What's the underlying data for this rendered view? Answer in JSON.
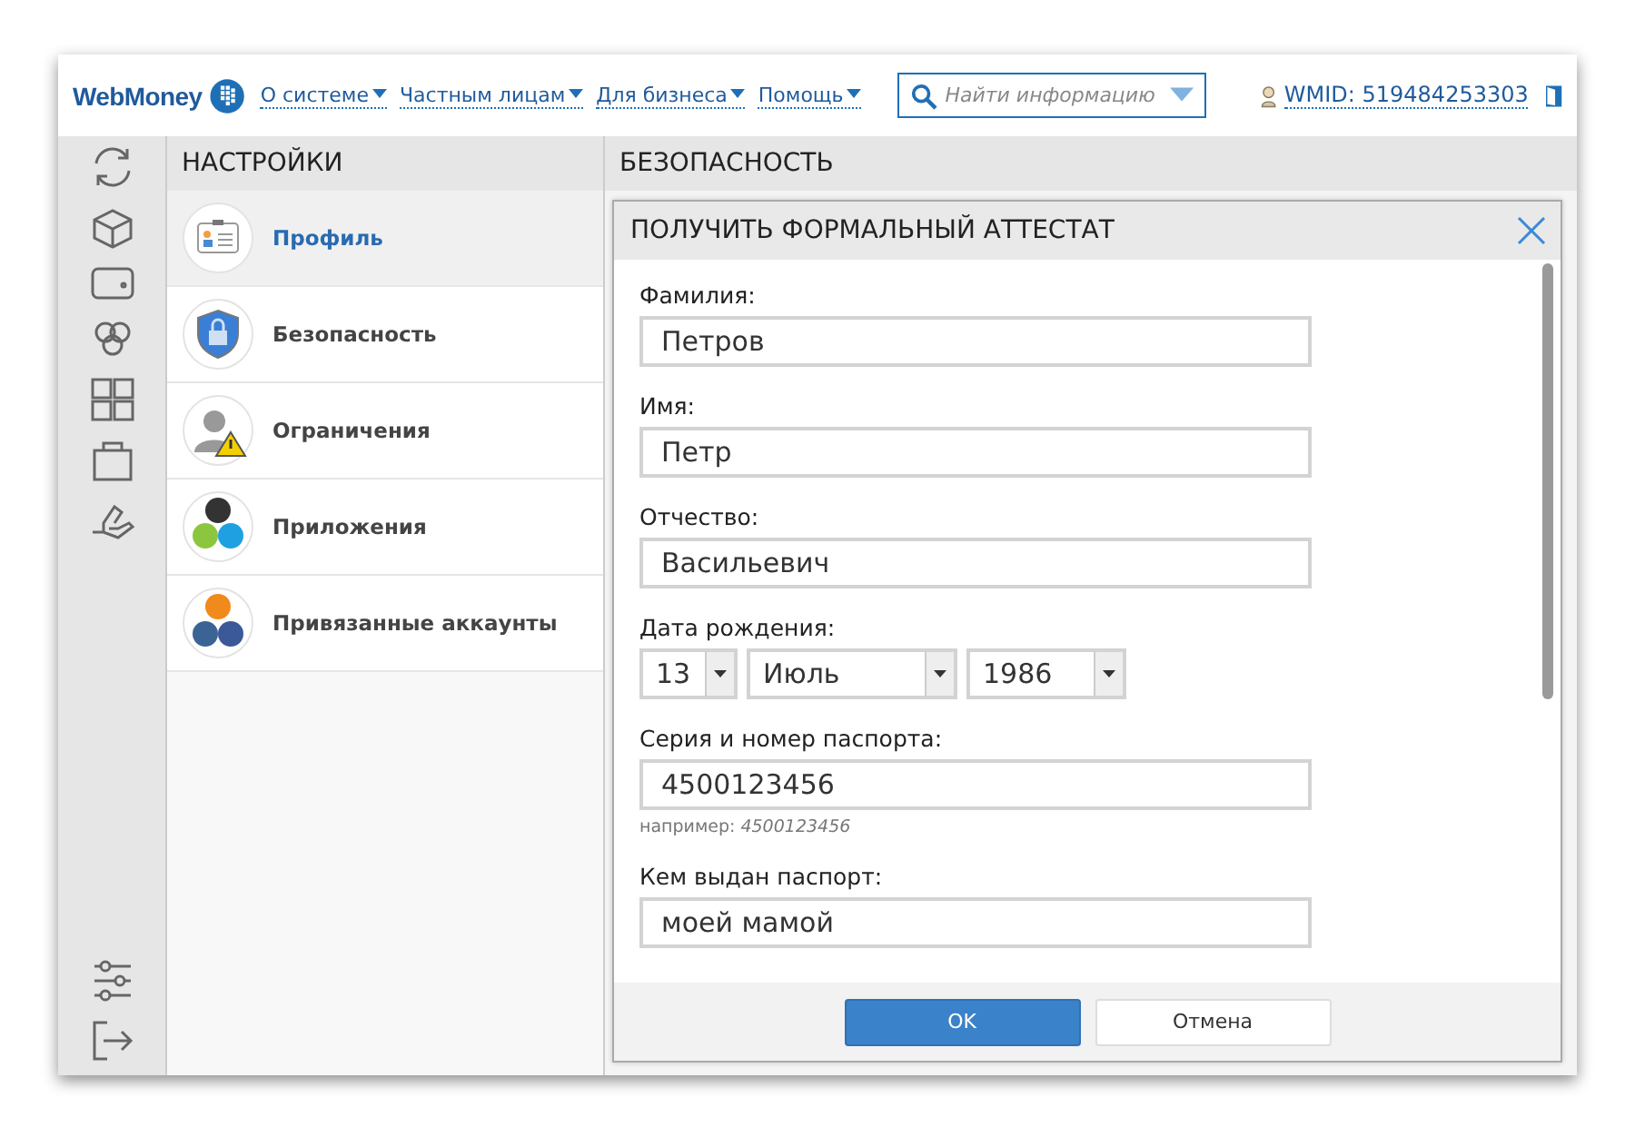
{
  "header": {
    "logo_text": "WebMoney",
    "nav": [
      {
        "label": "О системе"
      },
      {
        "label": "Частным лицам"
      },
      {
        "label": "Для бизнеса"
      },
      {
        "label": "Помощь"
      }
    ],
    "search": {
      "placeholder": "Найти информацию"
    },
    "wmid": "WMID: 519484253303"
  },
  "settings": {
    "title": "НАСТРОЙКИ",
    "items": [
      {
        "kind": "profile",
        "label": "Профиль",
        "selected": true
      },
      {
        "kind": "security",
        "label": "Безопасность",
        "selected": false
      },
      {
        "kind": "restrictions",
        "label": "Ограничения",
        "selected": false
      },
      {
        "kind": "apps",
        "label": "Приложения",
        "selected": false
      },
      {
        "kind": "accounts",
        "label": "Привязанные аккаунты",
        "selected": false
      }
    ]
  },
  "section": {
    "title": "БЕЗОПАСНОСТЬ"
  },
  "dialog": {
    "title": "ПОЛУЧИТЬ ФОРМАЛЬНЫЙ АТТЕСТАТ",
    "fields": [
      {
        "kind": "text",
        "label": "Фамилия:",
        "value": "Петров"
      },
      {
        "kind": "text",
        "label": "Имя:",
        "value": "Петр"
      },
      {
        "kind": "text",
        "label": "Отчество:",
        "value": "Васильевич"
      },
      {
        "kind": "date",
        "label": "Дата рождения:",
        "parts": [
          {
            "value": "13"
          },
          {
            "value": "Июль"
          },
          {
            "value": "1986"
          }
        ]
      },
      {
        "kind": "text",
        "label": "Серия и номер паспорта:",
        "value": "4500123456",
        "hint": "например: *4500123456*"
      },
      {
        "kind": "text",
        "label": "Кем выдан паспорт:",
        "value": "моей мамой"
      }
    ],
    "buttons": [
      {
        "kind": "primary",
        "label": "OK"
      },
      {
        "kind": "secondary",
        "label": "Отмена"
      }
    ]
  }
}
